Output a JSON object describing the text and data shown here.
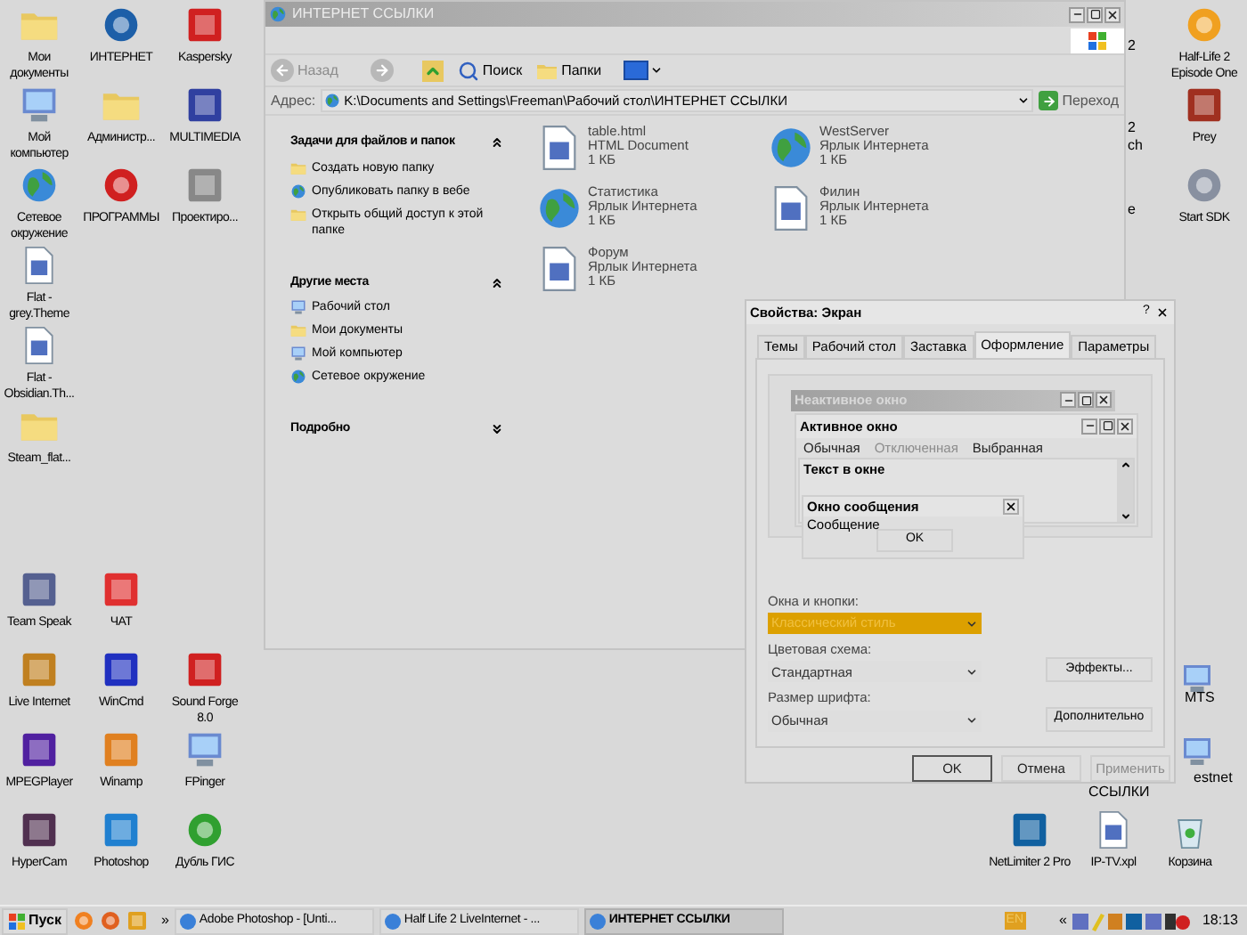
{
  "desktop_icons": [
    {
      "label": "Мои документы"
    },
    {
      "label": "ИНТЕРНЕТ"
    },
    {
      "label": "Kaspersky"
    },
    {
      "label": "Мой компьютер"
    },
    {
      "label": "Администр..."
    },
    {
      "label": "MULTIMEDIA"
    },
    {
      "label": "Сетевое окружение"
    },
    {
      "label": "ПРОГРАММЫ"
    },
    {
      "label": "Проектиро..."
    },
    {
      "label": "Flat - grey.Theme"
    },
    {
      "label": "Flat - Obsidian.Th..."
    },
    {
      "label": "Steam_flat..."
    },
    {
      "label": "Half-Life 2 Episode One"
    },
    {
      "label": "Prey"
    },
    {
      "label": "Start SDK"
    },
    {
      "label": "Team Speak"
    },
    {
      "label": "ЧАТ"
    },
    {
      "label": "Live Internet"
    },
    {
      "label": "WinCmd"
    },
    {
      "label": "Sound Forge 8.0"
    },
    {
      "label": "MPEGPlayer"
    },
    {
      "label": "Winamp"
    },
    {
      "label": "FPinger"
    },
    {
      "label": "HyperCam"
    },
    {
      "label": "Photoshop"
    },
    {
      "label": "Дубль ГИС"
    },
    {
      "label": "NetLimiter 2 Pro"
    },
    {
      "label": "IP-TV.xpl"
    },
    {
      "label": "Корзина"
    }
  ],
  "partial_labels": [
    "2",
    "2",
    "ch",
    "e",
    "MTS",
    "estnet",
    "ССЫЛКИ"
  ],
  "explorer": {
    "title": "ИНТЕРНЕТ ССЫЛКИ",
    "toolbar": {
      "back": {
        "label": "Назад",
        "disabled": true
      },
      "search": "Поиск",
      "folders": "Папки"
    },
    "address": {
      "label": "Адрес:",
      "path": "K:\\Documents and Settings\\Freeman\\Рабочий стол\\ИНТЕРНЕТ ССЫЛКИ",
      "go": "Переход"
    },
    "panes": [
      {
        "title": "Задачи для файлов и папок",
        "expanded": true,
        "items": [
          "Создать новую папку",
          "Опубликовать папку в вебе",
          "Открыть общий доступ к этой папке"
        ]
      },
      {
        "title": "Другие места",
        "expanded": true,
        "items": [
          "Рабочий стол",
          "Мои документы",
          "Мой компьютер",
          "Сетевое окружение"
        ]
      },
      {
        "title": "Подробно",
        "expanded": false
      }
    ],
    "files": [
      {
        "name": "table.html",
        "type": "HTML Document",
        "size": "1 КБ"
      },
      {
        "name": "WestServer",
        "type": "Ярлык Интернета",
        "size": "1 КБ"
      },
      {
        "name": "Статистика",
        "type": "Ярлык Интернета",
        "size": "1 КБ"
      },
      {
        "name": "Филин",
        "type": "Ярлык Интернета",
        "size": "1 КБ"
      },
      {
        "name": "Форум",
        "type": "Ярлык Интернета",
        "size": "1 КБ"
      }
    ]
  },
  "dialog": {
    "title": "Свойства: Экран",
    "help": "?",
    "tabs": [
      {
        "label": "Темы",
        "selected": false
      },
      {
        "label": "Рабочий стол",
        "selected": false
      },
      {
        "label": "Заставка",
        "selected": false
      },
      {
        "label": "Оформление",
        "selected": true
      },
      {
        "label": "Параметры",
        "selected": false
      }
    ],
    "preview": {
      "inactive_title": "Неактивное окно",
      "active_title": "Активное окно",
      "menu": [
        {
          "label": "Обычная",
          "disabled": false
        },
        {
          "label": "Отключенная",
          "disabled": true
        },
        {
          "label": "Выбранная",
          "disabled": false
        }
      ],
      "window_text": "Текст в окне",
      "message_title": "Окно сообщения",
      "message": "Сообщение",
      "ok": "OK"
    },
    "fields": [
      {
        "label": "Окна и кнопки:",
        "value": "Классический стиль",
        "highlighted": true
      },
      {
        "label": "Цветовая схема:",
        "value": "Стандартная",
        "highlighted": false
      },
      {
        "label": "Размер шрифта:",
        "value": "Обычная",
        "highlighted": false
      }
    ],
    "side_buttons": [
      "Эффекты...",
      "Дополнительно"
    ],
    "buttons": [
      {
        "label": "OK",
        "default": true,
        "disabled": false
      },
      {
        "label": "Отмена",
        "default": false,
        "disabled": false
      },
      {
        "label": "Применить",
        "default": false,
        "disabled": true
      }
    ]
  },
  "taskbar": {
    "start": "Пуск",
    "more": "»",
    "tasks": [
      {
        "label": "Adobe Photoshop - [Unti...",
        "selected": false
      },
      {
        "label": "Half Life 2 LiveInternet - ...",
        "selected": false
      },
      {
        "label": "ИНТЕРНЕТ ССЫЛКИ",
        "selected": true
      }
    ],
    "language": "EN",
    "tray_expand": "«",
    "clock": "18:13"
  }
}
